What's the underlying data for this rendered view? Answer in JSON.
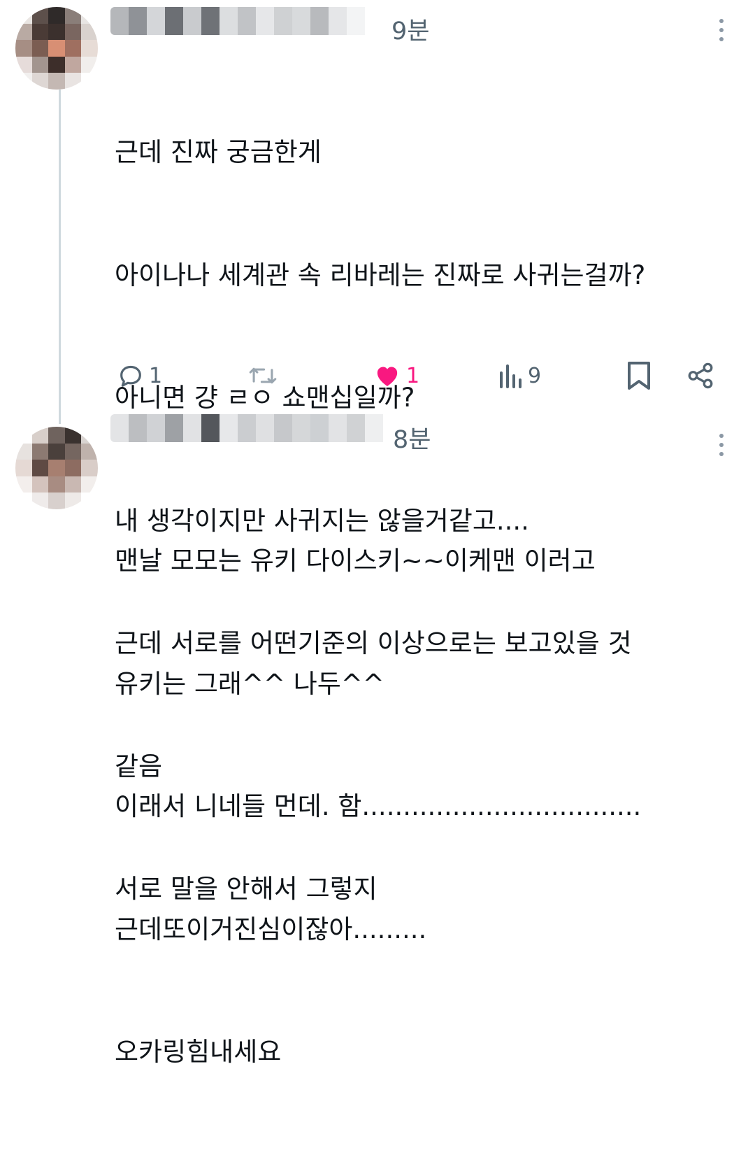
{
  "posts": [
    {
      "time": "9분",
      "lines": [
        "근데 진짜 궁금한게",
        "아이나나 세계관 속 리바레는 진짜로 사귀는걸까?",
        "아니면 걍 ㄹㅇ 쇼맨십일까?",
        "내 생각이지만 사귀지는 않을거같고....",
        "근데 서로를 어떤기준의 이상으로는 보고있을 것",
        "같음",
        "서로 말을 안해서 그렇지"
      ],
      "actions": {
        "reply_count": "1",
        "retweet_count": "",
        "like_count": "1",
        "view_count": "9"
      }
    },
    {
      "time": "8분",
      "lines": [
        "맨날 모모는 유키 다이스키~~이케맨 이러고",
        "유키는 그래^^ 나두^^",
        "이래서 니네들 먼데. 함..................................",
        "근데또이거진심이잖아.........",
        "오카링힘내세요"
      ]
    }
  ],
  "icons": {
    "reply": "reply-bubble-icon",
    "retweet": "retweet-icon",
    "like": "heart-filled-icon",
    "views": "views-bar-chart-icon",
    "bookmark": "bookmark-icon",
    "share": "share-icon",
    "more": "more-vertical-icon"
  },
  "colors": {
    "text": "#0f1419",
    "secondary": "#536471",
    "like": "#f91880",
    "thread_line": "#cfd9de"
  }
}
